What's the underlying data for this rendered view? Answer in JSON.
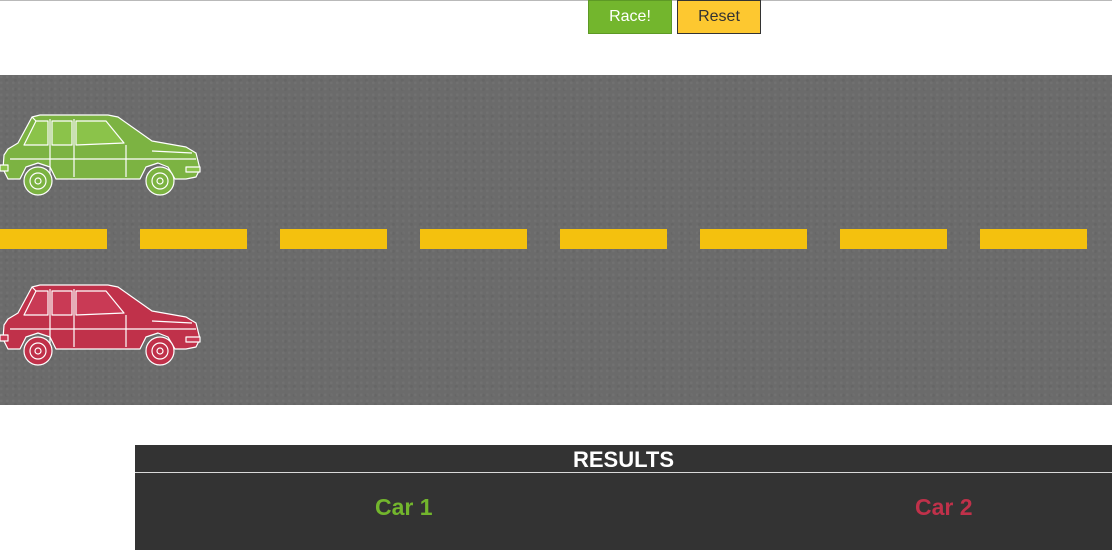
{
  "controls": {
    "race_label": "Race!",
    "reset_label": "Reset"
  },
  "track": {
    "asphalt_color": "#6b6b6b",
    "lane_marking_color": "#f4c10e",
    "cars": [
      {
        "name": "car-1",
        "color": "#7cb342",
        "icon": "hatchback-car-icon"
      },
      {
        "name": "car-2",
        "color": "#c0314a",
        "icon": "hatchback-car-icon"
      }
    ]
  },
  "results": {
    "title": "RESULTS",
    "car1_label": "Car 1",
    "car2_label": "Car 2",
    "car1_color": "#73b62d",
    "car2_color": "#c0314a"
  }
}
